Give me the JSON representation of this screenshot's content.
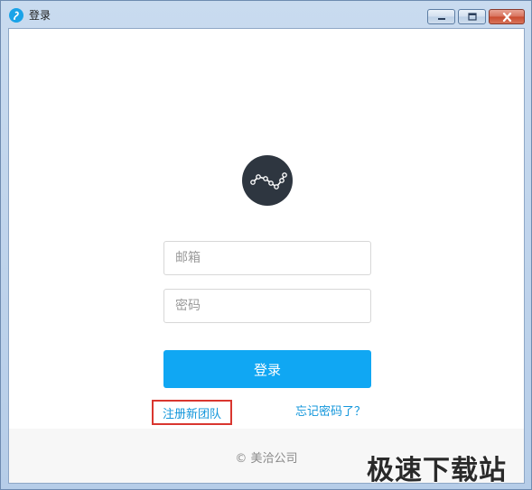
{
  "window": {
    "title": "登录",
    "app_icon": "app-logo-icon",
    "controls": {
      "minimize": "minimize-icon",
      "maximize": "maximize-icon",
      "close": "close-icon"
    }
  },
  "login": {
    "logo_icon": "line-chart-logo-icon",
    "email_placeholder": "邮箱",
    "password_placeholder": "密码",
    "submit_label": "登录",
    "register_label": "注册新团队",
    "forgot_label": "忘记密码了？",
    "accent_color": "#10a7f3",
    "link_color": "#1296db",
    "highlight_color": "#d9362f"
  },
  "footer": {
    "copyright": "© 美洽公司"
  },
  "watermark": {
    "text": "极速下载站"
  }
}
